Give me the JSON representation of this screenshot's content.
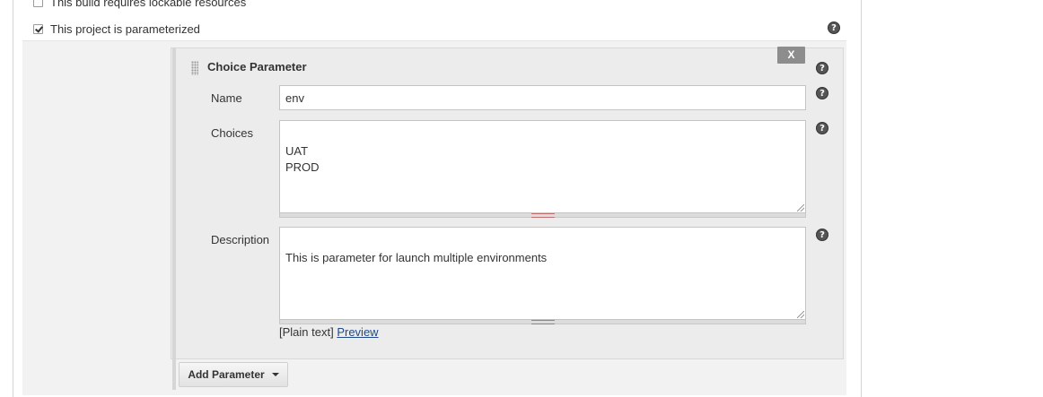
{
  "build_options": {
    "lockable_label": "This build requires lockable resources",
    "parameterized_label": "This project is parameterized"
  },
  "parameter": {
    "title": "Choice Parameter",
    "delete_label": "X",
    "name_label": "Name",
    "name_value": "env",
    "choices_label": "Choices",
    "choices_value": "UAT\nPROD",
    "description_label": "Description",
    "description_value": "This is parameter for launch multiple environments",
    "format_text": "[Plain text]",
    "preview_label": "Preview"
  },
  "add_parameter_label": "Add Parameter",
  "icons": {
    "help": "help-icon",
    "caret": "chevron-down-icon",
    "drag": "drag-handle-icon"
  }
}
